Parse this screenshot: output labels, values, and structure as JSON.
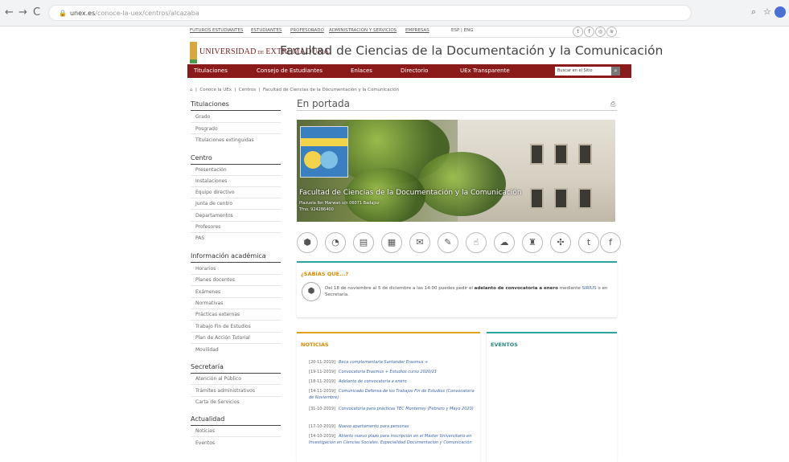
{
  "browser": {
    "url_host": "unex.es",
    "url_path": "/conoce-la-uex/centros/alcazaba",
    "back": "←",
    "forward": "→",
    "reload": "C"
  },
  "topbar": {
    "links": [
      "FUTUROS ESTUDIANTES",
      "ESTUDIANTES",
      "PROFESORADO",
      "ADMINISTRACIÓN Y SERVICIOS",
      "EMPRESAS"
    ],
    "lang": "ESP | ENG"
  },
  "brand": {
    "university_a": "UNIVERSIDAD",
    "university_b": "DE",
    "university_c": "EXTREMADURA",
    "faculty": "Facultad de Ciencias de la Documentación y la Comunicación"
  },
  "mainnav": {
    "items": [
      "Titulaciones",
      "Consejo de Estudiantes",
      "Enlaces",
      "Directorio",
      "UEx Transparente"
    ],
    "search_placeholder": "Buscar en el Sitio"
  },
  "breadcrumb": {
    "home": "⌂",
    "items": [
      "Conoce la UEx",
      "Centros",
      "Facultad de Ciencias de la Documentación y la Comunicación"
    ]
  },
  "sidebar": {
    "sections": [
      {
        "title": "Titulaciones",
        "items": [
          "Grado",
          "Posgrado",
          "Titulaciones extinguidas"
        ]
      },
      {
        "title": "Centro",
        "items": [
          "Presentación",
          "Instalaciones",
          "Equipo directivo",
          "Junta de centro",
          "Departamentos",
          "Profesores",
          "PAS"
        ]
      },
      {
        "title": "Información académica",
        "items": [
          "Horarios",
          "Planes docentes",
          "Exámenes",
          "Normativas",
          "Prácticas externas",
          "Trabajo Fin de Estudios",
          "Plan de Acción Tutorial",
          "Movilidad"
        ]
      },
      {
        "title": "Secretaría",
        "items": [
          "Atención al Público",
          "Trámites administrativos",
          "Carta de Servicios"
        ]
      },
      {
        "title": "Actualidad",
        "items": [
          "Noticias",
          "Eventos"
        ]
      }
    ]
  },
  "main": {
    "title": "En portada",
    "hero": {
      "title": "Facultad de Ciencias de la Documentación y la Comunicación",
      "address": "Plazuela Ibn Marwan s/n 06071 Badajoz",
      "phone": "Tfno. 924286400"
    },
    "sabias": {
      "title": "¿SABÍAS QUE...?",
      "text_a": "Del 18 de noviembre al 5 de diciembre a las 14:00 puedes pedir el ",
      "text_bold": "adelanto de convocatoria a enero",
      "text_b": " mediante ",
      "text_link": "SIRIUS",
      "text_c": " o en Secretaría."
    },
    "noticias": {
      "title": "NOTICIAS",
      "items": [
        {
          "date": "[20-11-2019]",
          "text": "Beca complementaria Santander Erasmus +"
        },
        {
          "date": "[19-11-2019]",
          "text": "Convocatoria Erasmus + Estudios curso 2020/21"
        },
        {
          "date": "[18-11-2019]",
          "text": "Adelanto de convocatoria a enero"
        },
        {
          "date": "[14-11-2019]",
          "text": "Comunicado Defensa de los Trabajos Fin de Estudios (Convocatoria de Noviembre)"
        },
        {
          "date": "[31-10-2019]",
          "text": "Convocatoria para prácticas TEC Monterrey (Febrero y Mayo 2020)"
        },
        {
          "date": "[17-10-2019]",
          "text": "Nuevo apartamento para personas"
        },
        {
          "date": "[14-10-2019]",
          "text": "Abierto nuevo plazo para inscripción en el Máster Universitario en Investigación en Ciencias Sociales. Especialidad Documentación y Comunicación"
        }
      ]
    },
    "eventos": {
      "title": "EVENTOS"
    }
  },
  "colors": {
    "nav": "#8b1a1a",
    "teal": "#2aa3a0",
    "gold": "#e0a51d"
  }
}
